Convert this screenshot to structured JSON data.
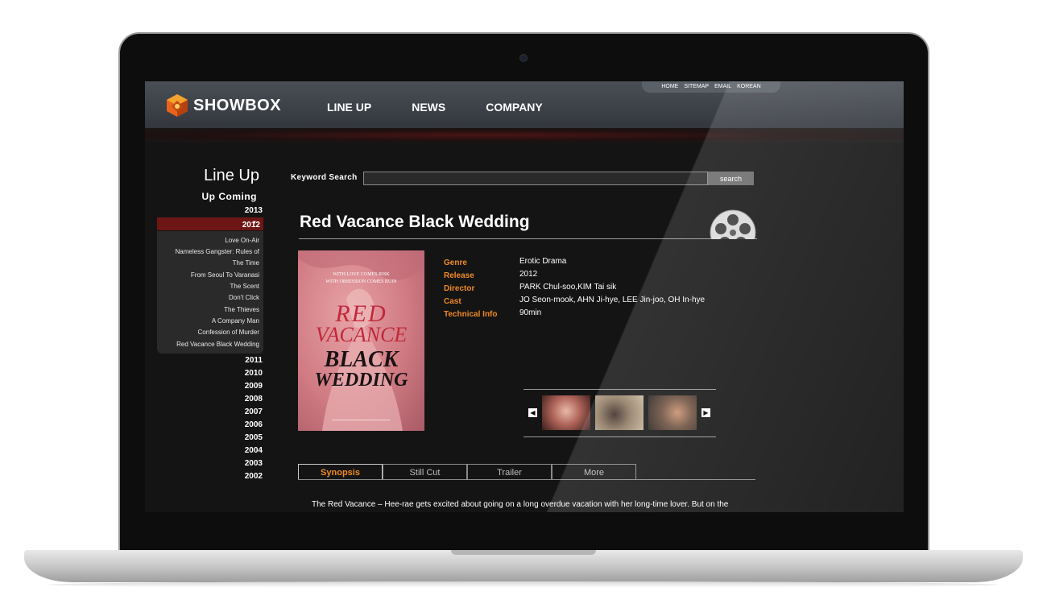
{
  "header": {
    "logo_text": "SHOWBOX",
    "nav": [
      "LINE UP",
      "NEWS",
      "COMPANY"
    ],
    "util_links": [
      "HOME",
      "SITEMAP",
      "EMAIL",
      "KOREAN"
    ]
  },
  "sidebar": {
    "title": "Line Up",
    "subtitle": "Up Coming",
    "years_before": [
      "2013"
    ],
    "active_year": "2012",
    "active_marker": "▼",
    "films": [
      "Love On-Air",
      "Nameless Gangster: Rules of",
      "The Time",
      "From Seoul To Varanasi",
      "The Scent",
      "Don't Click",
      "The Thieves",
      "A Company Man",
      "Confession of Murder",
      "Red Vacance Black Wedding"
    ],
    "years_after": [
      "2011",
      "2010",
      "2009",
      "2008",
      "2007",
      "2006",
      "2005",
      "2004",
      "2003",
      "2002"
    ]
  },
  "search": {
    "label": "Keyword Search",
    "value": "",
    "button": "search"
  },
  "movie": {
    "title": "Red Vacance Black Wedding",
    "poster": {
      "tagline_1": "WITH LOVE COMES RISK",
      "tagline_2": "WITH OBSESSION COMES RUIN",
      "word_1": "RED",
      "word_2": "VACANCE",
      "word_3": "BLACK",
      "word_4": "WEDDING"
    },
    "info": [
      {
        "label": "Genre",
        "value": "Erotic Drama"
      },
      {
        "label": "Release",
        "value": "2012"
      },
      {
        "label": "Director",
        "value": "PARK Chul-soo,KIM Tai sik"
      },
      {
        "label": "Cast",
        "value": "JO Seon-mook, AHN Ji-hye, LEE Jin-joo, OH In-hye"
      },
      {
        "label": "Technical Info",
        "value": "90min"
      }
    ]
  },
  "gallery": {
    "prev": "◀",
    "next": "▶"
  },
  "tabs": [
    "Synopsis",
    "Still Cut",
    "Trailer",
    "More"
  ],
  "synopsis": "The Red Vacance – Hee-rae gets excited about going on a long overdue vacation with her long-time lover. But on the",
  "colors": {
    "accent_orange": "#f08a24",
    "active_year_bg": "#6e1616"
  }
}
